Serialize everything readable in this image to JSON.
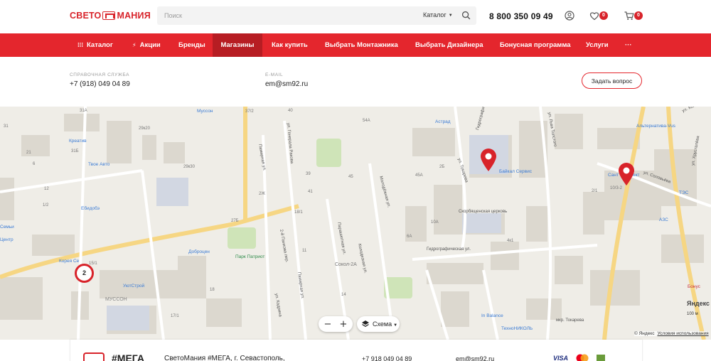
{
  "header": {
    "logo_left": "СВЕТО",
    "logo_right": "МАНИЯ",
    "search_placeholder": "Поиск",
    "search_category": "Каталог",
    "phone": "8 800 350 09 49",
    "favorites_count": "0",
    "cart_count": "0"
  },
  "nav": {
    "items": [
      {
        "label": "Каталог"
      },
      {
        "label": "Акции"
      },
      {
        "label": "Бренды"
      },
      {
        "label": "Магазины"
      },
      {
        "label": "Как купить"
      },
      {
        "label": "Выбрать Монтажника"
      },
      {
        "label": "Выбрать Дизайнера"
      },
      {
        "label": "Бонусная программа"
      },
      {
        "label": "Услуги"
      },
      {
        "label": "···"
      }
    ],
    "active_index": 3
  },
  "contacts": {
    "support_label": "Справочная служба",
    "support_phone": "+7 (918) 049 04 89",
    "email_label": "E-mail",
    "email": "em@sm92.ru",
    "ask_button": "Задать вопрос"
  },
  "map": {
    "cluster_count": "2",
    "zoom_out": "−",
    "zoom_in": "+",
    "layer_label": "Схема",
    "scale_label": "100 м",
    "yandex": "Яндекс",
    "copyright": "© Яндекс",
    "terms": "Условия использования",
    "streets": {
      "gidrograficheskaya_1": "Гидрографическая ул.",
      "gidrograficheskaya_2": "Гидрографическая ул.",
      "tokareva": "ул. Токарева",
      "lva_tolstogo": "ул. Льва Толстого",
      "kozhanova": "ул. Кожанова",
      "khrustaleva": "ул. Хрусталёва",
      "soloveva": "ул. Соловьёва",
      "pamirnaya": "Памирная ул.",
      "pamirnaya_2": "Памирная ул.",
      "generala_rakova": "ул. Генерала Ракова",
      "parashyutnaya": "Парашютная ул.",
      "kolodeznaya": "Колодезная ул.",
      "molodezhnaya": "Молодёжная ул.",
      "pankova": "2-й Панкова пер.",
      "kadrina": "ул. Кадрина",
      "mkr_tokareva": "мкр. Токарева"
    },
    "pois": {
      "musson_top": "Муссон",
      "kreativ": "Креатив",
      "tvoe_avto": "Твое Авто",
      "edidobi": "Ебидобэ",
      "semi": "Семьи",
      "centr": "Центр",
      "koreya": "Корея Се",
      "dobrocen": "Доброцен",
      "park": "Парк Патриот",
      "utstroy": "УютСтрой",
      "musson": "МУССОН",
      "sokol": "Сокол-2А",
      "astrad": "Астрад",
      "baikal": "Байкал Сервис",
      "skorbyaschenskaya": "Скорбященская церковь",
      "alternativa": "Альтернатива-Vus",
      "santech": "Сант",
      "santech_tail": "ект",
      "tes": "ТЭС",
      "azs": "АЗС",
      "bonus": "Бонус",
      "inbalance": "In Balance",
      "tehnonikol": "ТехноНИКОЛЬ"
    },
    "numbers": {
      "n1": "31А",
      "n2": "31Б",
      "n3": "29к20",
      "n4": "29к30",
      "n5": "37/2",
      "n6": "40",
      "n7": "39",
      "n8": "41",
      "n9": "45",
      "n10": "54А",
      "n11": "2Б",
      "n12": "45А",
      "n13": "10А",
      "n14": "6А",
      "n15": "4к1",
      "n16": "10/3-2",
      "n17": "2/1",
      "n18": "17/1",
      "n19": "15/1",
      "n20": "18",
      "n21": "27Б",
      "n22": "31",
      "n23": "21",
      "n24": "6",
      "n25": "12",
      "n26": "1/2",
      "n27": "18/1",
      "n28": "14",
      "n29": "11",
      "n30": "2Ж"
    }
  },
  "footer": {
    "brand_tag": "#МЕГА",
    "store_name": "СветоМания #МЕГА, г. Севастополь,",
    "phone": "+7 918 049 04 89",
    "email": "em@sm92.ru",
    "visa": "VISA"
  },
  "colors": {
    "brand_red": "#e4262d",
    "nav_active": "#b71d23",
    "map_bg": "#efede7",
    "park_green": "#cfe4b8"
  }
}
